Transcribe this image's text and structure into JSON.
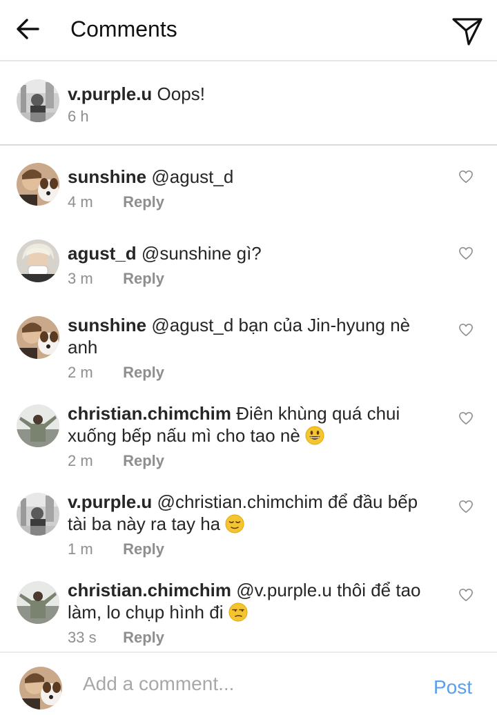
{
  "header": {
    "title": "Comments",
    "back_icon": "arrow-left-icon",
    "send_icon": "paper-plane-icon"
  },
  "caption": {
    "username": "v.purple.u",
    "text": "Oops!",
    "time": "6 h"
  },
  "comments": [
    {
      "username": "sunshine",
      "text": "@agust_d",
      "time": "4 m",
      "reply": "Reply"
    },
    {
      "username": "agust_d",
      "text": "@sunshine gì?",
      "time": "3 m",
      "reply": "Reply"
    },
    {
      "username": "sunshine",
      "text": "@agust_d bạn của Jin-hyung nè anh",
      "time": "2 m",
      "reply": "Reply"
    },
    {
      "username": "christian.chimchim",
      "text": "Điên khùng quá chui xuống bếp nấu mì cho tao nè",
      "emoji": "grinning-face-emoji",
      "time": "2 m",
      "reply": "Reply"
    },
    {
      "username": "v.purple.u",
      "text": "@christian.chimchim để đầu bếp tài ba này ra tay ha",
      "emoji": "relieved-face-emoji",
      "time": "1 m",
      "reply": "Reply"
    },
    {
      "username": "christian.chimchim",
      "text": "@v.purple.u thôi để tao làm, lo chụp hình đi",
      "emoji": "unamused-face-emoji",
      "time": "33 s",
      "reply": "Reply"
    }
  ],
  "composer": {
    "placeholder": "Add a comment...",
    "post_label": "Post"
  },
  "colors": {
    "link": "#5b9ee9",
    "muted": "#8e8e8e",
    "text": "#262626"
  }
}
